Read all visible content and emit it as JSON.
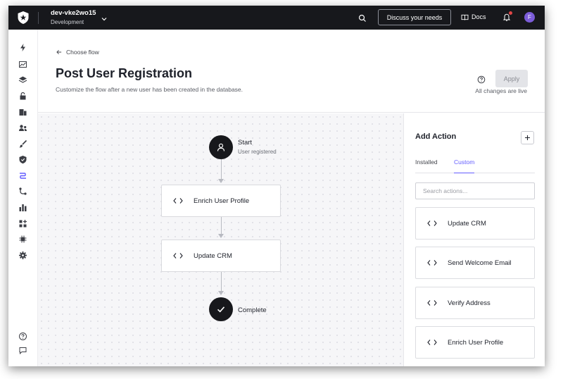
{
  "topbar": {
    "tenant_name": "dev-vke2wo15",
    "tenant_env": "Development",
    "discuss_label": "Discuss your needs",
    "docs_label": "Docs",
    "avatar_initial": "F"
  },
  "header": {
    "back_label": "Choose flow",
    "title": "Post User Registration",
    "subtitle": "Customize the flow after a new user has been created in the database.",
    "apply_label": "Apply",
    "live_status": "All changes are live"
  },
  "flow": {
    "start_label": "Start",
    "start_sublabel": "User registered",
    "actions": [
      {
        "label": "Enrich User Profile"
      },
      {
        "label": "Update CRM"
      }
    ],
    "end_label": "Complete"
  },
  "panel": {
    "title": "Add Action",
    "tabs": [
      {
        "label": "Installed"
      },
      {
        "label": "Custom"
      }
    ],
    "active_tab": "Custom",
    "search_placeholder": "Search actions...",
    "actions": [
      {
        "label": "Update CRM"
      },
      {
        "label": "Send Welcome Email"
      },
      {
        "label": "Verify Address"
      },
      {
        "label": "Enrich User Profile"
      }
    ]
  },
  "colors": {
    "accent": "#635dff",
    "topbar_bg": "#17181c",
    "avatar_bg": "#7b5cd8",
    "notification_dot": "#e04646"
  },
  "icons": {
    "sidebar": [
      "lightning-icon",
      "chart-icon",
      "layers-icon",
      "lock-icon",
      "building-icon",
      "users-icon",
      "brush-icon",
      "shield-check-icon",
      "flow-icon",
      "branch-icon",
      "bar-chart-icon",
      "extensions-icon",
      "chip-icon",
      "gear-icon",
      "help-circle-icon",
      "chat-icon"
    ]
  }
}
